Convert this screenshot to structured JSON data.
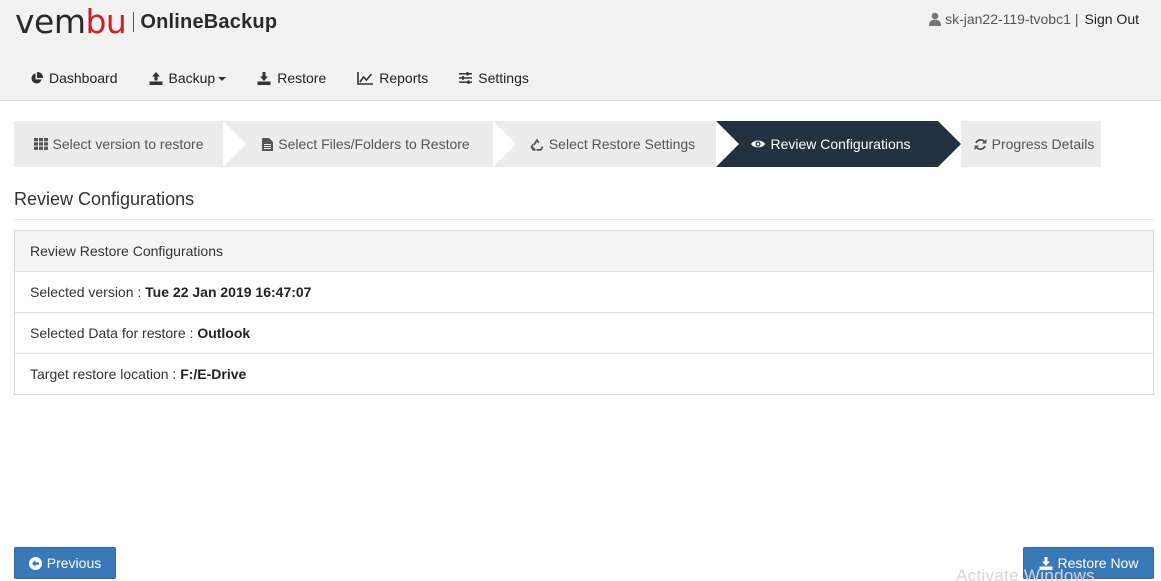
{
  "header": {
    "logo_brand_prefix": "vem",
    "logo_brand_red": "bu",
    "logo_product": "OnlineBackup",
    "user_name": "sk-jan22-119-tvobc1",
    "user_separator": "|",
    "signout_label": "Sign Out"
  },
  "nav": {
    "items": [
      {
        "label": "Dashboard",
        "icon": "pie-chart-icon"
      },
      {
        "label": "Backup",
        "icon": "upload-icon"
      },
      {
        "label": "Restore",
        "icon": "download-icon"
      },
      {
        "label": "Reports",
        "icon": "line-chart-icon"
      },
      {
        "label": "Settings",
        "icon": "sliders-icon"
      }
    ]
  },
  "wizard": {
    "steps": [
      {
        "label": "Select version to restore",
        "icon": "grid-icon"
      },
      {
        "label": "Select Files/Folders to Restore",
        "icon": "file-icon"
      },
      {
        "label": "Select Restore Settings",
        "icon": "recycle-icon"
      },
      {
        "label": "Review Configurations",
        "icon": "eye-icon",
        "active": true
      },
      {
        "label": "Progress Details",
        "icon": "refresh-icon"
      }
    ]
  },
  "page": {
    "title": "Review Configurations"
  },
  "panel": {
    "heading": "Review Restore Configurations",
    "rows": [
      {
        "label": "Selected version : ",
        "value": "Tue 22 Jan 2019 16:47:07"
      },
      {
        "label": "Selected Data for restore : ",
        "value": "Outlook"
      },
      {
        "label": "Target restore location : ",
        "value": "F:/E-Drive"
      }
    ]
  },
  "buttons": {
    "previous_label": "Previous",
    "restore_now_label": "Restore Now"
  },
  "watermark": "Activate Windows",
  "colors": {
    "brand_red": "#cc1f2c",
    "active_step": "#233140",
    "primary_button": "#3a79b8"
  }
}
